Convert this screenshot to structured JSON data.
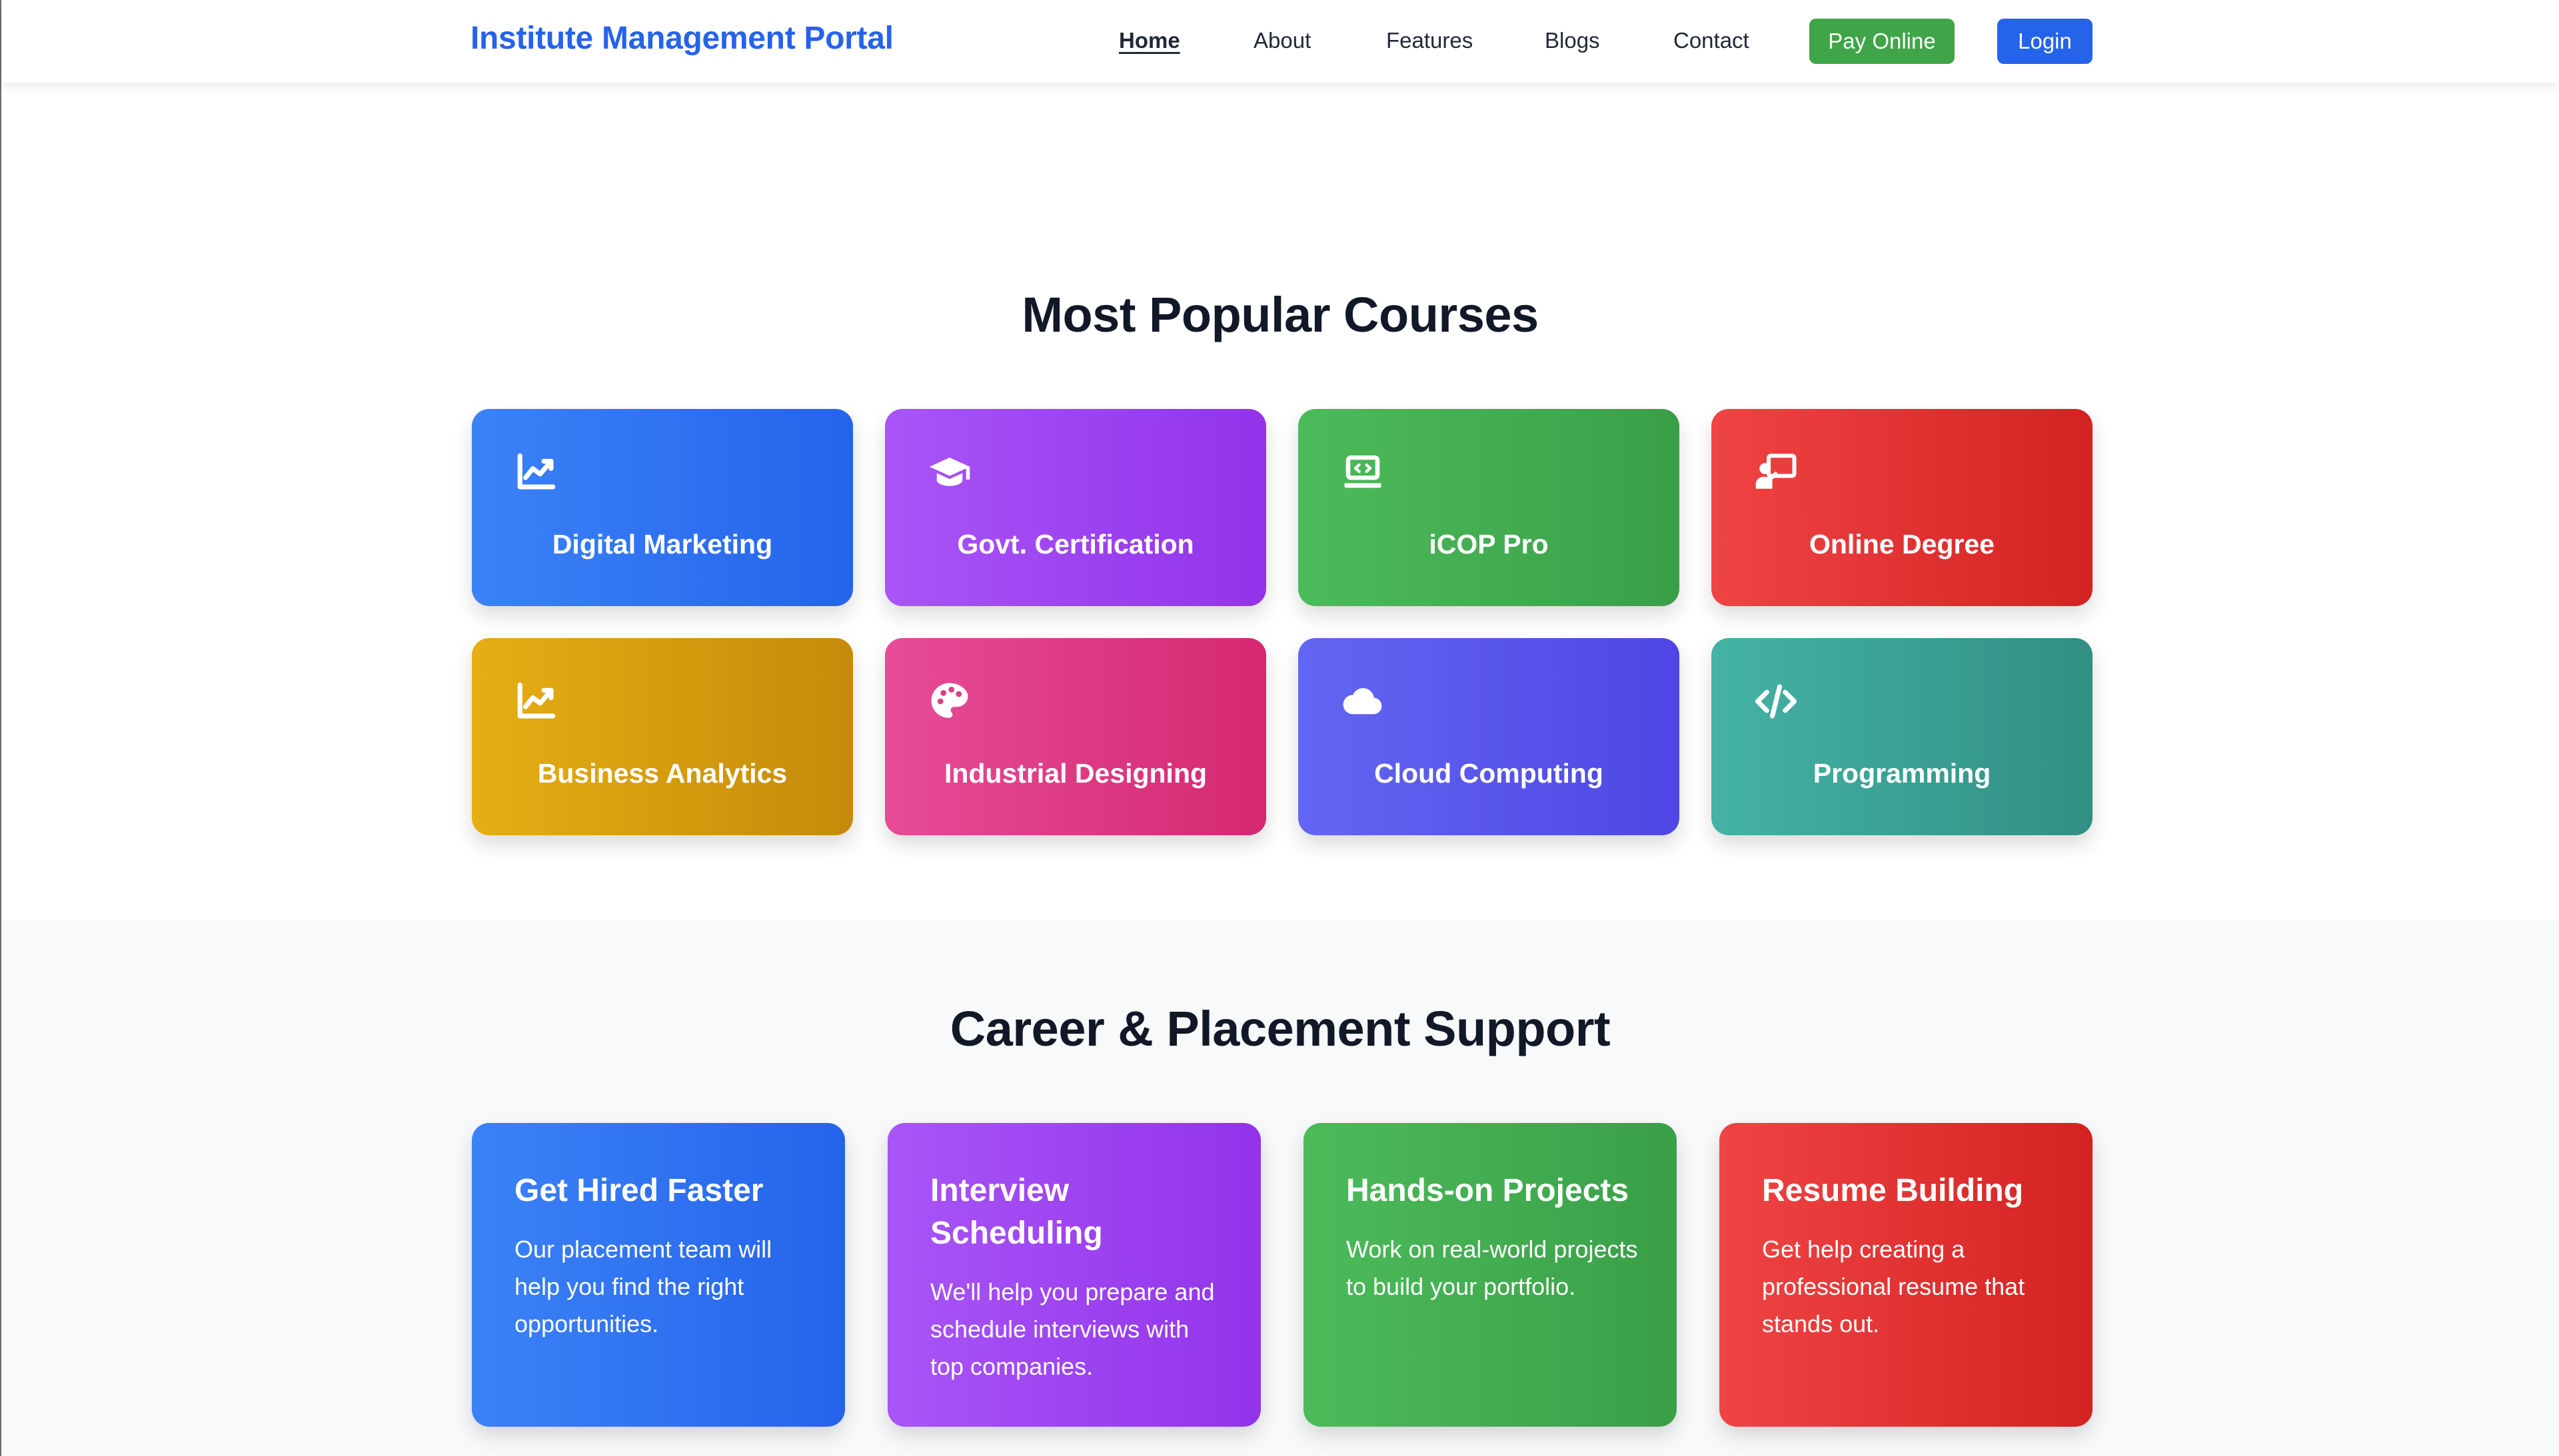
{
  "header": {
    "brand": "Institute Management Portal",
    "nav": [
      "Home",
      "About",
      "Features",
      "Blogs",
      "Contact"
    ],
    "active_nav": "Home",
    "pay_button": "Pay Online",
    "login_button": "Login",
    "colors": {
      "brand": "#2563eb",
      "pay": "#3fa548",
      "login": "#2563eb"
    }
  },
  "courses": {
    "title": "Most Popular Courses",
    "items": [
      {
        "label": "Digital Marketing",
        "icon": "chart-line-icon",
        "color": "blue"
      },
      {
        "label": "Govt. Certification",
        "icon": "graduation-cap-icon",
        "color": "purple"
      },
      {
        "label": "iCOP Pro",
        "icon": "laptop-code-icon",
        "color": "green"
      },
      {
        "label": "Online Degree",
        "icon": "chalkboard-teacher-icon",
        "color": "red"
      },
      {
        "label": "Business Analytics",
        "icon": "chart-line-icon",
        "color": "yellow"
      },
      {
        "label": "Industrial Designing",
        "icon": "palette-icon",
        "color": "pink"
      },
      {
        "label": "Cloud Computing",
        "icon": "cloud-icon",
        "color": "indigo"
      },
      {
        "label": "Programming",
        "icon": "code-icon",
        "color": "teal"
      }
    ]
  },
  "career": {
    "title": "Career & Placement Support",
    "items": [
      {
        "title": "Get Hired Faster",
        "desc": "Our placement team will help you find the right opportunities."
      },
      {
        "title": "Interview Scheduling",
        "desc": "We'll help you prepare and schedule interviews with top companies."
      },
      {
        "title": "Hands-on Projects",
        "desc": "Work on real-world projects to build your portfolio."
      },
      {
        "title": "Resume Building",
        "desc": "Get help creating a professional resume that stands out."
      }
    ]
  }
}
